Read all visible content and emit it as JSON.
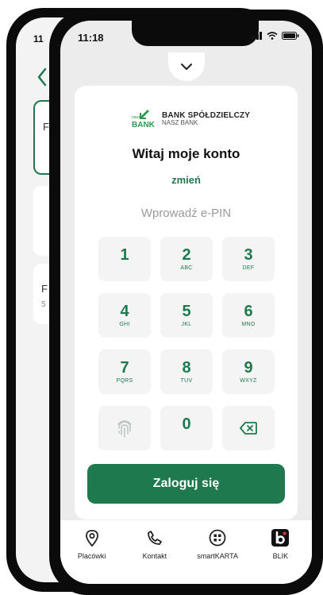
{
  "back_phone": {
    "time": "11",
    "card1": "F",
    "card2": "",
    "card3": "F",
    "card3_sub": "5"
  },
  "status": {
    "time": "11:18"
  },
  "logo": {
    "mark_small": "nasz",
    "mark_big": "BANK",
    "line1": "BANK SPÓŁDZIELCZY",
    "line2": "NASZ BANK"
  },
  "login": {
    "greeting": "Witaj moje konto",
    "change_link": "zmień",
    "pin_placeholder": "Wprowadź e-PIN",
    "button": "Zaloguj się"
  },
  "keypad": {
    "k1": {
      "digit": "1",
      "letters": ""
    },
    "k2": {
      "digit": "2",
      "letters": "ABC"
    },
    "k3": {
      "digit": "3",
      "letters": "DEF"
    },
    "k4": {
      "digit": "4",
      "letters": "GHI"
    },
    "k5": {
      "digit": "5",
      "letters": "JKL"
    },
    "k6": {
      "digit": "6",
      "letters": "MNO"
    },
    "k7": {
      "digit": "7",
      "letters": "PQRS"
    },
    "k8": {
      "digit": "8",
      "letters": "TUV"
    },
    "k9": {
      "digit": "9",
      "letters": "WXYZ"
    },
    "k0": {
      "digit": "0",
      "letters": ""
    },
    "fingerprint_icon": "fingerprint-icon",
    "backspace_icon": "backspace-icon"
  },
  "tabs": [
    {
      "label": "Placówki",
      "icon": "location-pin-icon"
    },
    {
      "label": "Kontakt",
      "icon": "phone-icon"
    },
    {
      "label": "smartKARTA",
      "icon": "smart-card-icon"
    },
    {
      "label": "BLIK",
      "icon": "blik-icon"
    }
  ],
  "colors": {
    "brand_green": "#1e7a4e",
    "key_background": "#f3f4f3",
    "placeholder": "#9a9a9a"
  }
}
